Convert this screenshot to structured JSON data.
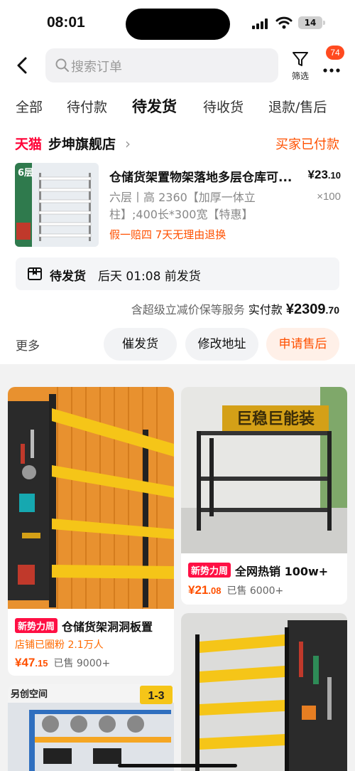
{
  "status_bar": {
    "time": "08:01",
    "battery": "14"
  },
  "header": {
    "search_placeholder": "搜索订单",
    "filter_label": "筛选",
    "message_badge": "74"
  },
  "tabs": [
    {
      "label": "全部"
    },
    {
      "label": "待付款"
    },
    {
      "label": "待发货",
      "active": true
    },
    {
      "label": "待收货"
    },
    {
      "label": "退款/售后"
    }
  ],
  "order": {
    "store_logo": "天猫",
    "store_name": "步坤旗舰店",
    "status": "买家已付款",
    "product": {
      "title": "仓储货架置物架落地多层仓库可...",
      "price_int": "¥23",
      "price_dec": ".10",
      "spec": "六层丨高 2360【加厚一体立柱】;400长*300宽【特惠】",
      "qty": "×100",
      "services": "假一赔四  7天无理由退换",
      "thumb_text": "6层"
    },
    "shipping": {
      "status": "待发货",
      "time": "后天 01:08 前发货"
    },
    "payment": {
      "note": "含超级立减价保等服务",
      "label": "实付款",
      "amount_int": "¥2309",
      "amount_dec": ".70"
    },
    "actions": {
      "more": "更多",
      "urge": "催发货",
      "modify_address": "修改地址",
      "after_sale": "申请售后"
    }
  },
  "recommendations": [
    {
      "tag": "新势力周",
      "title": "仓储货架洞洞板置",
      "fans": "店铺已圈粉 2.1万人",
      "price_int": "¥47",
      "price_dec": ".15",
      "sold": "已售 9000+"
    },
    {
      "tag": "新势力周",
      "title": "全网热销 100w+",
      "price_int": "¥21",
      "price_dec": ".08",
      "sold": "已售 6000+",
      "image_text": "巨稳巨能装"
    },
    {
      "image_text": "另创空间",
      "badge_text": "1-3"
    },
    {}
  ],
  "colors": {
    "accent": "#ff5000",
    "tmall_red": "#ff0036",
    "tag_red": "#ff0f44",
    "shelf_yellow": "#f5c518",
    "shelf_orange": "#f5a623"
  }
}
